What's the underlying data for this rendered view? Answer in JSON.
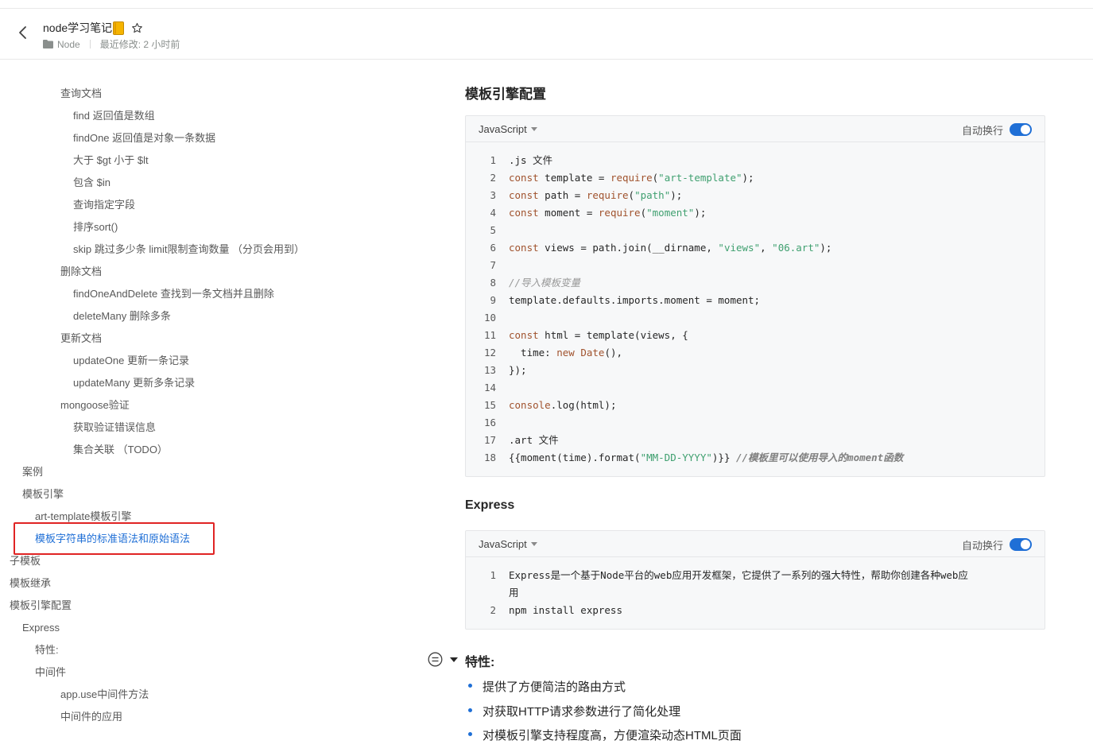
{
  "header": {
    "title": "node学习笔记",
    "folder": "Node",
    "modified": "最近修改: 2 小时前"
  },
  "outline": [
    {
      "label": "查询文档",
      "active": false
    },
    {
      "label": "find 返回值是数组",
      "active": false
    },
    {
      "label": "findOne 返回值是对象一条数据",
      "active": false
    },
    {
      "label": "大于 $gt 小于 $lt",
      "active": false
    },
    {
      "label": "包含 $in",
      "active": false
    },
    {
      "label": "查询指定字段",
      "active": false
    },
    {
      "label": "排序sort()",
      "active": false
    },
    {
      "label": "skip 跳过多少条 limit限制查询数量 （分页会用到）",
      "active": false
    },
    {
      "label": "删除文档",
      "active": false
    },
    {
      "label": "findOneAndDelete 查找到一条文档并且删除",
      "active": false
    },
    {
      "label": "deleteMany 删除多条",
      "active": false
    },
    {
      "label": "更新文档",
      "active": false
    },
    {
      "label": "updateOne 更新一条记录",
      "active": false
    },
    {
      "label": "updateMany 更新多条记录",
      "active": false
    },
    {
      "label": "mongoose验证",
      "active": false
    },
    {
      "label": "获取验证错误信息",
      "active": false
    },
    {
      "label": "集合关联 （TODO）",
      "active": false
    },
    {
      "label": "案例",
      "active": false
    },
    {
      "label": "模板引擎",
      "active": false
    },
    {
      "label": "art-template模板引擎",
      "active": false
    },
    {
      "label": "模板字符串的标准语法和原始语法",
      "active": true
    },
    {
      "label": "子模板",
      "active": false
    },
    {
      "label": "模板继承",
      "active": false
    },
    {
      "label": "模板引擎配置",
      "active": false
    },
    {
      "label": "Express",
      "active": false
    },
    {
      "label": "特性:",
      "active": false
    },
    {
      "label": "中间件",
      "active": false
    },
    {
      "label": "app.use中间件方法",
      "active": false
    },
    {
      "label": "中间件的应用",
      "active": false
    }
  ],
  "content": {
    "heading1": "模板引擎配置",
    "heading2": "Express",
    "heading3": "特性:",
    "code1": {
      "lang": "JavaScript",
      "wrap": "自动换行",
      "line_numbers": [
        "1",
        "2",
        "3",
        "4",
        "5",
        "6",
        "7",
        "8",
        "9",
        "10",
        "11",
        "12",
        "13",
        "14",
        "15",
        "16",
        "17",
        "18"
      ]
    },
    "code2": {
      "lang": "JavaScript",
      "wrap": "自动换行",
      "line_numbers": [
        "1",
        "2"
      ],
      "line1a": "Express是一个基于Node平台的web应用开发框架，它提供了一系列的强大特性，帮助你创建各种web应",
      "line1b": "用",
      "line2": "npm install express"
    },
    "features": [
      "提供了方便简洁的路由方式",
      "对获取HTTP请求参数进行了简化处理",
      "对模板引擎支持程度高，方便渲染动态HTML页面"
    ]
  },
  "colors": {
    "accent": "#1f6fd6",
    "highlight_border": "#e02424"
  }
}
